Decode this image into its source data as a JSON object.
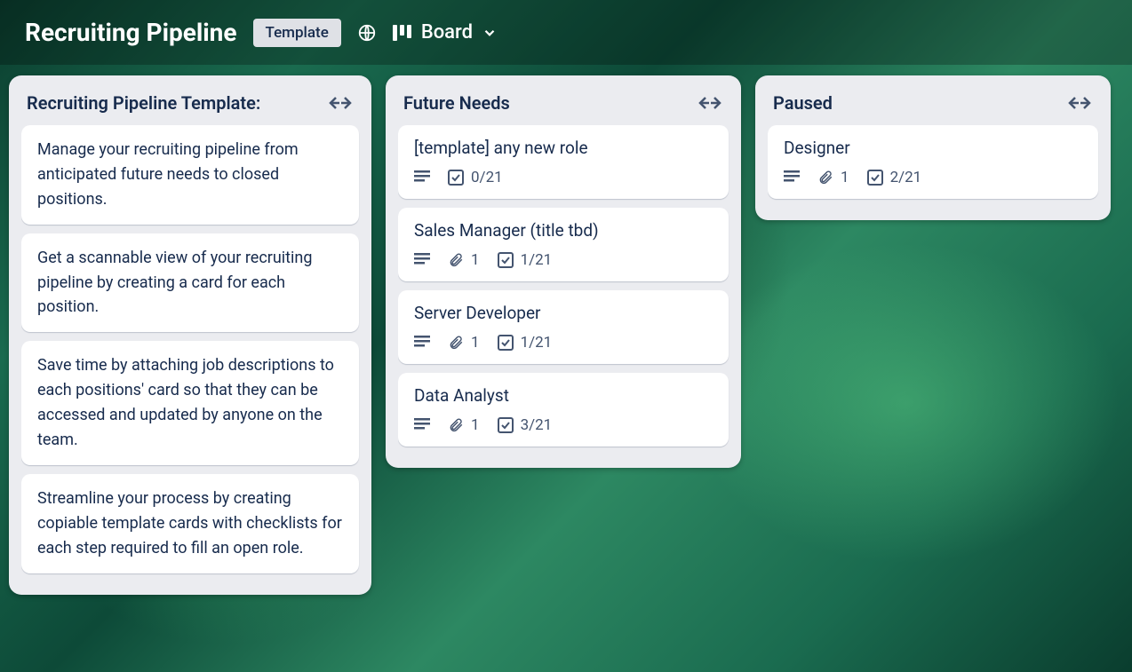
{
  "header": {
    "title": "Recruiting Pipeline",
    "badge": "Template",
    "view_label": "Board"
  },
  "lists": [
    {
      "title": "Recruiting Pipeline Template:",
      "cards": [
        {
          "text": "Manage your recruiting pipeline from anticipated future needs to closed positions."
        },
        {
          "text": "Get a scannable view of your recruiting pipeline by creating a card for each position."
        },
        {
          "text": "Save time by attaching job descriptions to each positions' card so that they can be accessed and updated by anyone on the team."
        },
        {
          "text": "Streamline your process by creating copiable template cards with checklists for each step required to fill an open role."
        }
      ]
    },
    {
      "title": "Future Needs",
      "cards": [
        {
          "title": "[template] any new role",
          "description": true,
          "checklist": "0/21"
        },
        {
          "title": "Sales Manager (title tbd)",
          "description": true,
          "attachments": "1",
          "checklist": "1/21"
        },
        {
          "title": "Server Developer",
          "description": true,
          "attachments": "1",
          "checklist": "1/21"
        },
        {
          "title": "Data Analyst",
          "description": true,
          "attachments": "1",
          "checklist": "3/21"
        }
      ]
    },
    {
      "title": "Paused",
      "cards": [
        {
          "title": "Designer",
          "description": true,
          "attachments": "1",
          "checklist": "2/21"
        }
      ]
    }
  ]
}
